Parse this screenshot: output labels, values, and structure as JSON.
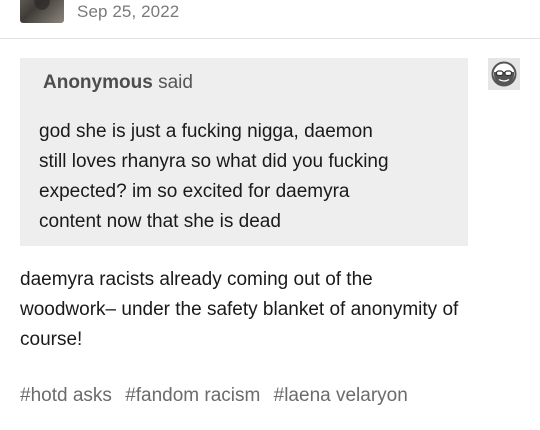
{
  "post": {
    "date": "Sep 25, 2022",
    "more_icon": "more-horizontal-icon"
  },
  "ask": {
    "asker_name": "Anonymous",
    "said_label": "said",
    "asker_avatar_icon": "anonymous-sunglasses-avatar-icon",
    "lines": [
      "god she is just a fucking nigga, daemon",
      "still loves rhanyra so what did you fucking",
      "expected? im so excited for daemyra",
      "content now that she is dead"
    ]
  },
  "answer": {
    "lines": [
      "daemyra racists already coming out of the",
      "woodwork– under the safety blanket of anonymity of",
      "course!"
    ]
  },
  "tags": [
    "#hotd asks",
    "#fandom racism",
    "#laena velaryon"
  ],
  "colors": {
    "ask_background": "#eeeeee",
    "divider": "#e3e3e3",
    "date_text": "#7a7a7a",
    "tag_text": "#6b6b6b"
  }
}
